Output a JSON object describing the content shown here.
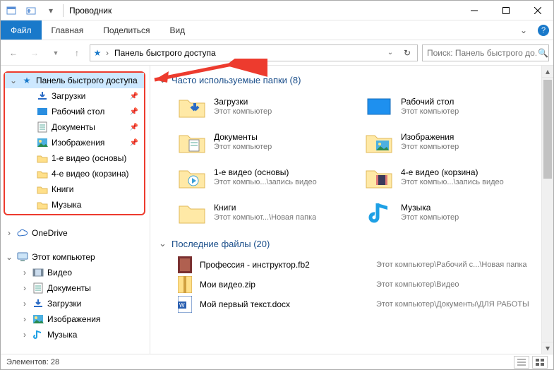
{
  "titlebar": {
    "title": "Проводник"
  },
  "ribbon": {
    "file": "Файл",
    "tabs": [
      "Главная",
      "Поделиться",
      "Вид"
    ]
  },
  "addressbar": {
    "location": "Панель быстрого доступа"
  },
  "search": {
    "placeholder": "Поиск: Панель быстрого до..."
  },
  "sidebar": {
    "quick_access": {
      "label": "Панель быстрого доступа",
      "items": [
        {
          "label": "Загрузки",
          "icon": "downloads",
          "pinned": true
        },
        {
          "label": "Рабочий стол",
          "icon": "desktop",
          "pinned": true
        },
        {
          "label": "Документы",
          "icon": "documents",
          "pinned": true
        },
        {
          "label": "Изображения",
          "icon": "pictures",
          "pinned": true
        },
        {
          "label": "1-е видео (основы)",
          "icon": "folder",
          "pinned": false
        },
        {
          "label": "4-е видео (корзина)",
          "icon": "folder",
          "pinned": false
        },
        {
          "label": "Книги",
          "icon": "folder",
          "pinned": false
        },
        {
          "label": "Музыка",
          "icon": "folder",
          "pinned": false
        }
      ]
    },
    "onedrive": {
      "label": "OneDrive"
    },
    "this_pc": {
      "label": "Этот компьютер",
      "items": [
        {
          "label": "Видео",
          "icon": "videos"
        },
        {
          "label": "Документы",
          "icon": "documents"
        },
        {
          "label": "Загрузки",
          "icon": "downloads"
        },
        {
          "label": "Изображения",
          "icon": "pictures"
        },
        {
          "label": "Музыка",
          "icon": "music"
        }
      ]
    }
  },
  "groups": {
    "frequent": {
      "title": "Часто используемые папки (8)",
      "items": [
        {
          "name": "Загрузки",
          "loc": "Этот компьютер",
          "icon": "downloads"
        },
        {
          "name": "Рабочий стол",
          "loc": "Этот компьютер",
          "icon": "desktop"
        },
        {
          "name": "Документы",
          "loc": "Этот компьютер",
          "icon": "documents"
        },
        {
          "name": "Изображения",
          "loc": "Этот компьютер",
          "icon": "pictures"
        },
        {
          "name": "1-е видео (основы)",
          "loc": "Этот компью...\\запись видео",
          "icon": "folder-video"
        },
        {
          "name": "4-е видео (корзина)",
          "loc": "Этот компью...\\запись видео",
          "icon": "folder-video2"
        },
        {
          "name": "Книги",
          "loc": "Этот компьют...\\Новая папка",
          "icon": "folder"
        },
        {
          "name": "Музыка",
          "loc": "Этот компьютер",
          "icon": "music"
        }
      ]
    },
    "recent": {
      "title": "Последние файлы (20)",
      "items": [
        {
          "name": "Профессия - инструктор.fb2",
          "loc": "Этот компьютер\\Рабочий с...\\Новая папка",
          "icon": "fb2"
        },
        {
          "name": "Мои видео.zip",
          "loc": "Этот компьютер\\Видео",
          "icon": "zip"
        },
        {
          "name": "Мой первый текст.docx",
          "loc": "Этот компьютер\\Документы\\ДЛЯ РАБОТЫ",
          "icon": "docx"
        }
      ]
    }
  },
  "statusbar": {
    "items_label": "Элементов: 28"
  }
}
